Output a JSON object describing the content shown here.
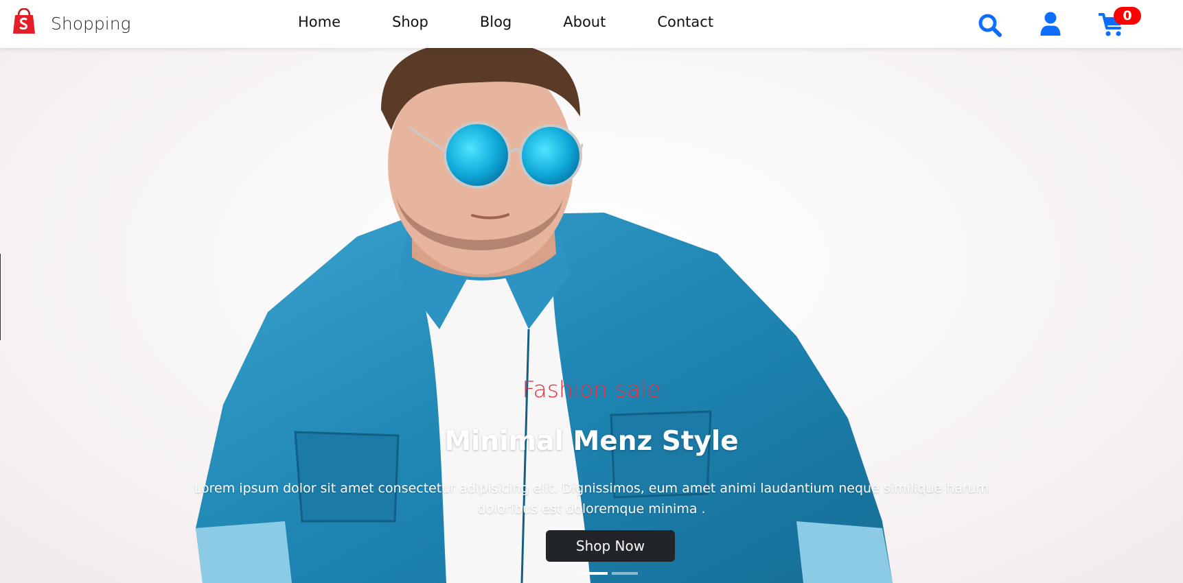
{
  "header": {
    "brand_name": "Shopping",
    "brand_logo_icon": "shopify-bag-icon",
    "nav": [
      {
        "label": "Home"
      },
      {
        "label": "Shop"
      },
      {
        "label": "Blog"
      },
      {
        "label": "About"
      },
      {
        "label": "Contact"
      }
    ],
    "icons": {
      "search": "search-icon",
      "account": "user-icon",
      "cart": "shopping-cart-icon"
    },
    "cart_count": "0",
    "colors": {
      "icon_accent": "#0d6efd",
      "badge": "#ff0000",
      "logo": "#e41e26"
    }
  },
  "hero": {
    "eyebrow": "Fashion sale",
    "title": "Minimal Menz Style",
    "description": "Lorem ipsum dolor sit amet consectetur adipisicing elit. Dignissimos, eum amet animi laudantium neque similique harum doloribus est doloremque minima .",
    "cta_label": "Shop Now",
    "slide_count": 2,
    "active_slide": 1,
    "colors": {
      "eyebrow": "#e8303f",
      "button": "#212529"
    }
  }
}
